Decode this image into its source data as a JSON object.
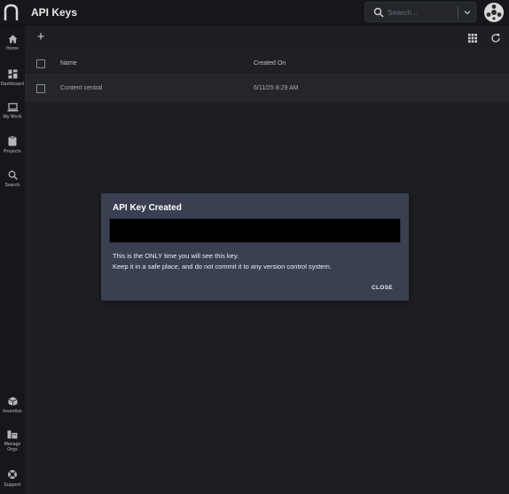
{
  "header": {
    "title": "API Keys",
    "search_placeholder": "Search...",
    "logo_icon": "brand-arch-icon",
    "avatar_icon": "user-avatar-icon"
  },
  "sidebar": {
    "items": [
      {
        "label": "Home",
        "icon": "home-icon"
      },
      {
        "label": "Dashboard",
        "icon": "dashboard-icon"
      },
      {
        "label": "My Work",
        "icon": "laptop-icon"
      },
      {
        "label": "Projects",
        "icon": "clipboard-icon"
      },
      {
        "label": "Search",
        "icon": "search-icon"
      }
    ],
    "bottom_items": [
      {
        "label": "Inventize",
        "icon": "box-icon"
      },
      {
        "label": "Manage Orgs",
        "icon": "folder-icon"
      },
      {
        "label": "Support",
        "icon": "lifebuoy-icon"
      }
    ]
  },
  "toolbar": {
    "add_label": "+",
    "add_icon": "plus-icon",
    "grid_icon": "grid-view-icon",
    "refresh_icon": "refresh-icon"
  },
  "table": {
    "columns": [
      "Name",
      "Created On"
    ],
    "rows": [
      {
        "name": "Content central",
        "created_on": "6/11/25 8:29 AM"
      }
    ]
  },
  "dialog": {
    "title": "API Key Created",
    "key_value": "",
    "message_line1": "This is the ONLY time you will see this key.",
    "message_line2": "Keep it in a safe place, and do not commit it to any version control system.",
    "close_label": "CLOSE"
  },
  "colors": {
    "background": "#1e1f24",
    "topbar": "#16171b",
    "dialog": "#3a3f52",
    "key_field": "#000000"
  }
}
